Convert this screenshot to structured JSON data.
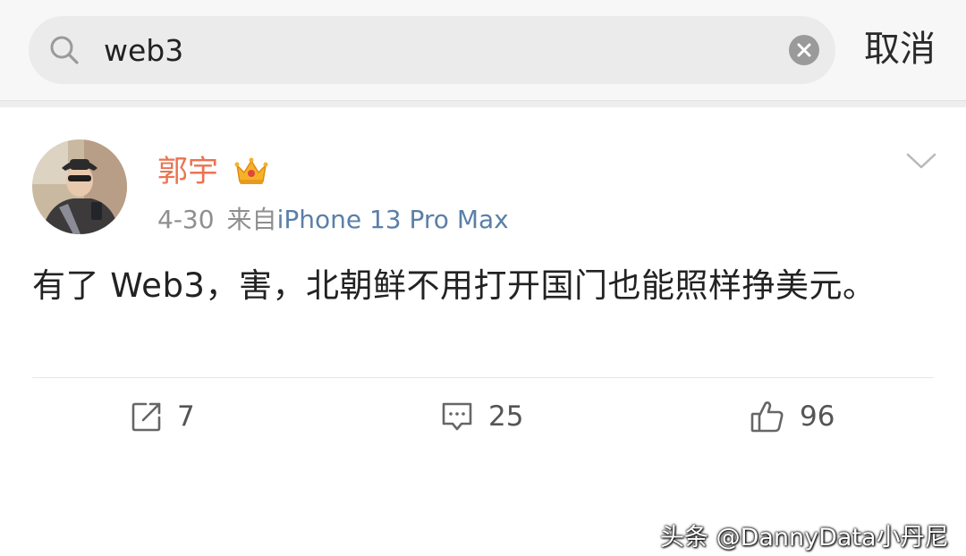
{
  "search": {
    "value": "web3",
    "cancel_label": "取消"
  },
  "post": {
    "author": "郭宇",
    "date": "4-30",
    "source_prefix": "来自",
    "source_device": "iPhone 13 Pro Max",
    "text": "有了 Web3，害，北朝鲜不用打开国门也能照样挣美元。",
    "actions": {
      "repost_count": "7",
      "comment_count": "25",
      "like_count": "96"
    }
  },
  "watermark": "头条 @DannyData小丹尼",
  "icons": {
    "search": "search-icon",
    "clear": "clear-icon",
    "vip": "vip-crown-icon",
    "more": "chevron-down-icon",
    "repost": "repost-icon",
    "comment": "comment-icon",
    "like": "like-icon"
  },
  "colors": {
    "author": "#eb7350",
    "source_link": "#5b7fa8",
    "meta": "#8f8f8f",
    "header_bg": "#f7f7f7",
    "search_box_bg": "#ebebeb"
  }
}
